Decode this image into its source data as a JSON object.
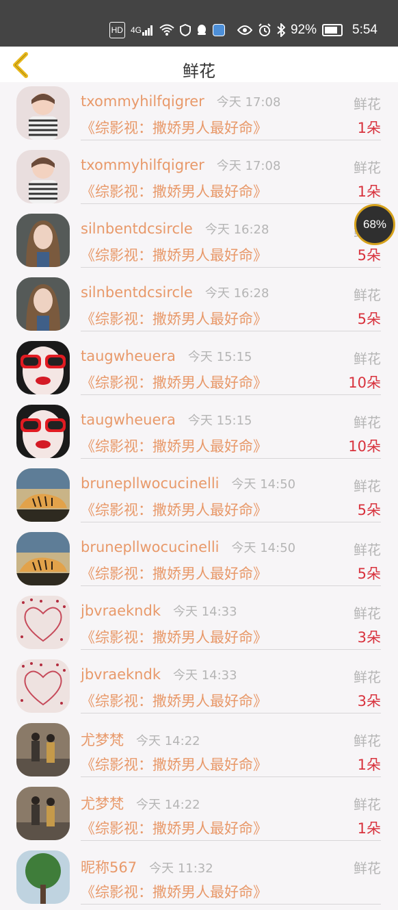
{
  "status_bar": {
    "hd": "HD",
    "network": "4G",
    "battery_percent": "92%",
    "time": "5:54"
  },
  "header": {
    "title": "鲜花"
  },
  "floating_badge": {
    "value": "68%"
  },
  "items": [
    {
      "name": "txommyhilfqigrer",
      "time": "今天 17:08",
      "gift": "鲜花",
      "show": "《综影视：撒娇男人最好命》",
      "count": "1朵",
      "avatar": "girl-striped-shirt"
    },
    {
      "name": "txommyhilfqigrer",
      "time": "今天 17:08",
      "gift": "鲜花",
      "show": "《综影视：撒娇男人最好命》",
      "count": "1朵",
      "avatar": "girl-striped-shirt"
    },
    {
      "name": "silnbentdcsircle",
      "time": "今天 16:28",
      "gift": "鲜花",
      "show": "《综影视：撒娇男人最好命》",
      "count": "5朵",
      "avatar": "woman-portrait"
    },
    {
      "name": "silnbentdcsircle",
      "time": "今天 16:28",
      "gift": "鲜花",
      "show": "《综影视：撒娇男人最好命》",
      "count": "5朵",
      "avatar": "woman-portrait"
    },
    {
      "name": "taugwheuera",
      "time": "今天 15:15",
      "gift": "鲜花",
      "show": "《综影视：撒娇男人最好命》",
      "count": "10朵",
      "avatar": "red-sunglasses"
    },
    {
      "name": "taugwheuera",
      "time": "今天 15:15",
      "gift": "鲜花",
      "show": "《综影视：撒娇男人最好命》",
      "count": "10朵",
      "avatar": "red-sunglasses"
    },
    {
      "name": "brunepllwocucinelli",
      "time": "今天 14:50",
      "gift": "鲜花",
      "show": "《综影视：撒娇男人最好命》",
      "count": "5朵",
      "avatar": "tiger"
    },
    {
      "name": "brunepllwocucinelli",
      "time": "今天 14:50",
      "gift": "鲜花",
      "show": "《综影视：撒娇男人最好命》",
      "count": "5朵",
      "avatar": "tiger"
    },
    {
      "name": "jbvraekndk",
      "time": "今天 14:33",
      "gift": "鲜花",
      "show": "《综影视：撒娇男人最好命》",
      "count": "3朵",
      "avatar": "heart-petals"
    },
    {
      "name": "jbvraekndk",
      "time": "今天 14:33",
      "gift": "鲜花",
      "show": "《综影视：撒娇男人最好命》",
      "count": "3朵",
      "avatar": "heart-petals"
    },
    {
      "name": "尤梦梵",
      "time": "今天 14:22",
      "gift": "鲜花",
      "show": "《综影视：撒娇男人最好命》",
      "count": "1朵",
      "avatar": "couple-street"
    },
    {
      "name": "尤梦梵",
      "time": "今天 14:22",
      "gift": "鲜花",
      "show": "《综影视：撒娇男人最好命》",
      "count": "1朵",
      "avatar": "couple-street"
    },
    {
      "name": "昵称567",
      "time": "今天 11:32",
      "gift": "鲜花",
      "show": "《综影视：撒娇男人最好命》",
      "count": "",
      "avatar": "green-tree"
    }
  ],
  "colors": {
    "name": "#e8996a",
    "count": "#d8323d",
    "muted": "#b5b5b5",
    "back_arrow": "#e8b81c",
    "status_bar": "#444444"
  }
}
